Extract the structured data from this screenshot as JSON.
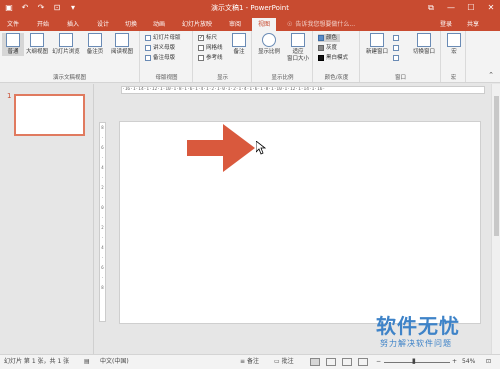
{
  "titlebar": {
    "title": "演示文稿1 - PowerPoint",
    "qat": {
      "save": "▣",
      "undo": "↶",
      "redo": "↷",
      "present": "⊡",
      "more": "▾"
    },
    "winctl": {
      "ribbon_options": "⧉",
      "minimize": "—",
      "maximize": "☐",
      "close": "✕"
    }
  },
  "tabs": [
    {
      "label": "文件",
      "active": false
    },
    {
      "label": "开始",
      "active": false
    },
    {
      "label": "插入",
      "active": false
    },
    {
      "label": "设计",
      "active": false
    },
    {
      "label": "切换",
      "active": false
    },
    {
      "label": "动画",
      "active": false
    },
    {
      "label": "幻灯片放映",
      "active": false
    },
    {
      "label": "审阅",
      "active": false
    },
    {
      "label": "视图",
      "active": true
    }
  ],
  "tell_me": "告诉我您想要做什么...",
  "login": "登录",
  "share": "共享",
  "ribbon": {
    "views_group": {
      "label": "演示文稿视图",
      "buttons": [
        "普通",
        "大纲视图",
        "幻灯片浏览",
        "备注页",
        "阅读视图"
      ]
    },
    "master_group": {
      "label": "母版视图",
      "buttons": [
        "幻灯片母版",
        "讲义母版",
        "备注母版"
      ]
    },
    "show_group": {
      "label": "显示",
      "checks": [
        {
          "label": "标尺",
          "checked": true
        },
        {
          "label": "网格线",
          "checked": false
        },
        {
          "label": "参考线",
          "checked": false
        }
      ],
      "notes": "备注"
    },
    "zoom_group": {
      "label": "显示比例",
      "buttons": [
        "显示比例",
        "适应\n窗口大小"
      ]
    },
    "color_group": {
      "label": "颜色/灰度",
      "buttons": [
        "颜色",
        "灰度",
        "黑白模式"
      ]
    },
    "window_group": {
      "label": "窗口",
      "buttons": [
        "新建窗口",
        "切换窗口"
      ]
    },
    "macro_group": {
      "label": "宏",
      "buttons": [
        "宏"
      ]
    }
  },
  "thumbnail": {
    "number": "1"
  },
  "hruler_text": "·16·1·14·1·12·1·10·1·8·1·6·1·4·1·2·1·0·1·2·1·4·1·6·1·8·1·10·1·12·1·14·1·16·",
  "vruler_marks": [
    "8",
    "·",
    "6",
    "·",
    "4",
    "·",
    "2",
    "·",
    "0",
    "·",
    "2",
    "·",
    "4",
    "·",
    "6",
    "·",
    "8"
  ],
  "slide": {
    "shape": "right-arrow",
    "shape_color": "#d9593d"
  },
  "status": {
    "slide_info": "幻灯片 第 1 张，共 1 张",
    "language": "中文(中国)",
    "notes": "备注",
    "comments": "批注",
    "zoom": "54%"
  },
  "watermark": {
    "title": "软件无忧",
    "subtitle": "努力解决软件问题"
  },
  "colors": {
    "accent": "#c84b30",
    "ribbon_bg": "#f3f3f3",
    "canvas_bg": "#e6e6e6",
    "watermark": "#3e83c8"
  }
}
